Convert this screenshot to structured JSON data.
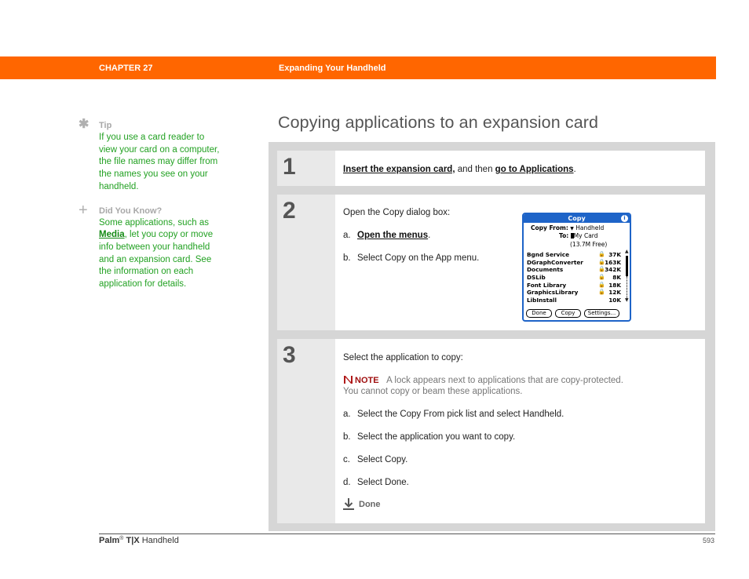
{
  "header": {
    "chapter": "CHAPTER 27",
    "title": "Expanding Your Handheld",
    "band_color": "#ff6600"
  },
  "sidebar": {
    "tip": {
      "icon": "asterisk-icon",
      "heading": "Tip",
      "text": "If you use a card reader to view your card on a computer, the file names may differ from the names you see on your handheld."
    },
    "did_you_know": {
      "icon": "plus-icon",
      "heading": "Did You Know?",
      "text_before": "Some applications, such as ",
      "link": "Media",
      "text_after": ", let you copy or move info between your handheld and an expansion card. See the information on each application for details."
    }
  },
  "page_title": "Copying applications to an expansion card",
  "steps": [
    {
      "number": "1",
      "link1": "Insert the expansion card,",
      "middle": " and then ",
      "link2": "go to Applications",
      "end": "."
    },
    {
      "number": "2",
      "intro": "Open the Copy dialog box:",
      "a_label": "a.",
      "a_link": "Open the menus",
      "a_end": ".",
      "b_label": "b.",
      "b_text": "Select Copy on the App menu."
    },
    {
      "number": "3",
      "intro": "Select the application to copy:",
      "note_label": "NOTE",
      "note_text_1": "A lock appears next to applications that are copy-protected.",
      "note_text_2": "You cannot copy or beam these applications.",
      "items": [
        {
          "label": "a.",
          "text": "Select the Copy From pick list and select Handheld."
        },
        {
          "label": "b.",
          "text": "Select the application you want to copy."
        },
        {
          "label": "c.",
          "text": "Select Copy."
        },
        {
          "label": "d.",
          "text": "Select Done."
        }
      ],
      "done_label": "Done"
    }
  ],
  "palm_dialog": {
    "title": "Copy",
    "info_glyph": "i",
    "copy_from_label": "Copy From:",
    "copy_from_value": "Handheld",
    "to_label": "To:",
    "to_value": "My Card",
    "free_space": "(13.7M Free)",
    "apps": [
      {
        "name": "Bgnd Service",
        "locked": true,
        "size": "37K"
      },
      {
        "name": "DGraphConverter",
        "locked": true,
        "size": "163K"
      },
      {
        "name": "Documents",
        "locked": true,
        "size": "342K"
      },
      {
        "name": "DSLib",
        "locked": true,
        "size": "8K"
      },
      {
        "name": "Font Library",
        "locked": true,
        "size": "18K"
      },
      {
        "name": "GraphicsLibrary",
        "locked": true,
        "size": "12K"
      },
      {
        "name": "LibInstall",
        "locked": false,
        "size": "10K"
      }
    ],
    "buttons": [
      "Done",
      "Copy",
      "Settings..."
    ],
    "accent_color": "#1e64c8"
  },
  "footer": {
    "brand": "Palm",
    "reg": "®",
    "model": "T|X",
    "product": "Handheld",
    "page_number": "593"
  }
}
